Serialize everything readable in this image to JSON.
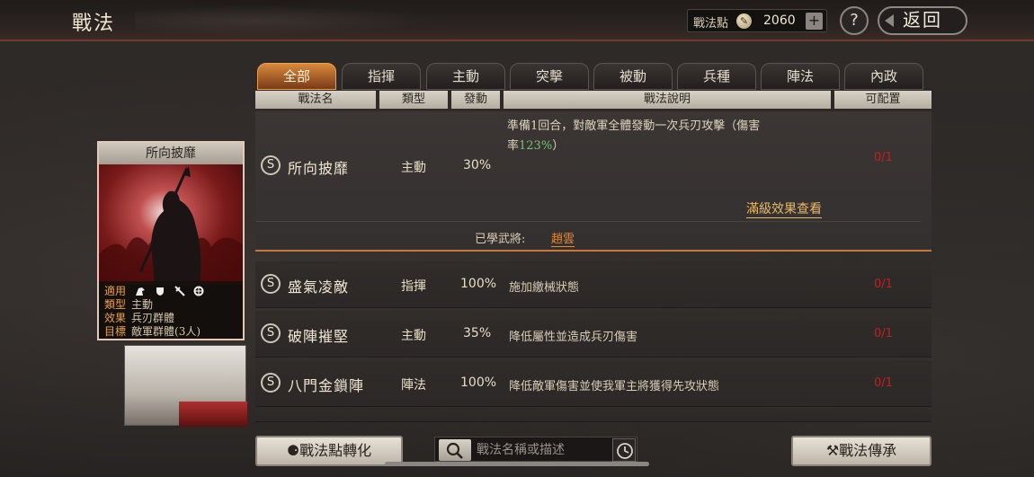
{
  "header": {
    "title": "戰法",
    "points_label": "戰法點",
    "points_value": "2060",
    "help": "?",
    "back_label": "返回"
  },
  "tabs": [
    "全部",
    "指揮",
    "主動",
    "突擊",
    "被動",
    "兵種",
    "陣法",
    "內政"
  ],
  "columns": [
    "戰法名",
    "類型",
    "發動",
    "戰法說明",
    "可配置"
  ],
  "selected": {
    "badge": "S",
    "name": "所向披靡",
    "type": "主動",
    "rate": "30%",
    "desc_1": "準備1回合，對敵軍全體發動一次兵刃攻擊（傷害",
    "desc_2a": "率",
    "desc_2b": "123%",
    "desc_2c": "）",
    "capacity": "0/1",
    "full_effect": "滿級效果查看",
    "learned_label": "已學武將:",
    "learned_general": "趙雲"
  },
  "rows": [
    {
      "badge": "S",
      "name": "盛氣凌敵",
      "type": "指揮",
      "rate": "100%",
      "desc": "施加繳械狀態",
      "capacity": "0/1"
    },
    {
      "badge": "S",
      "name": "破陣摧堅",
      "type": "主動",
      "rate": "35%",
      "desc": "降低屬性並造成兵刃傷害",
      "capacity": "0/1"
    },
    {
      "badge": "S",
      "name": "八門金鎖陣",
      "type": "陣法",
      "rate": "100%",
      "desc": "降低敵軍傷害並使我軍主將獲得先攻狀態",
      "capacity": "0/1"
    }
  ],
  "card": {
    "title": "所向披靡",
    "apply_label": "適用",
    "type_label": "類型",
    "type_value": "主動",
    "effect_label": "效果",
    "effect_value": "兵刃群體",
    "target_label": "目標",
    "target_value": "敵軍群體(3人)",
    "apply_icons": [
      "cavalry-icon",
      "shield-icon",
      "bow-icon",
      "wheel-icon"
    ]
  },
  "bottom": {
    "convert_label": "戰法點轉化",
    "search_placeholder": "戰法名稱或描述",
    "inherit_label": "戰法傳承"
  }
}
